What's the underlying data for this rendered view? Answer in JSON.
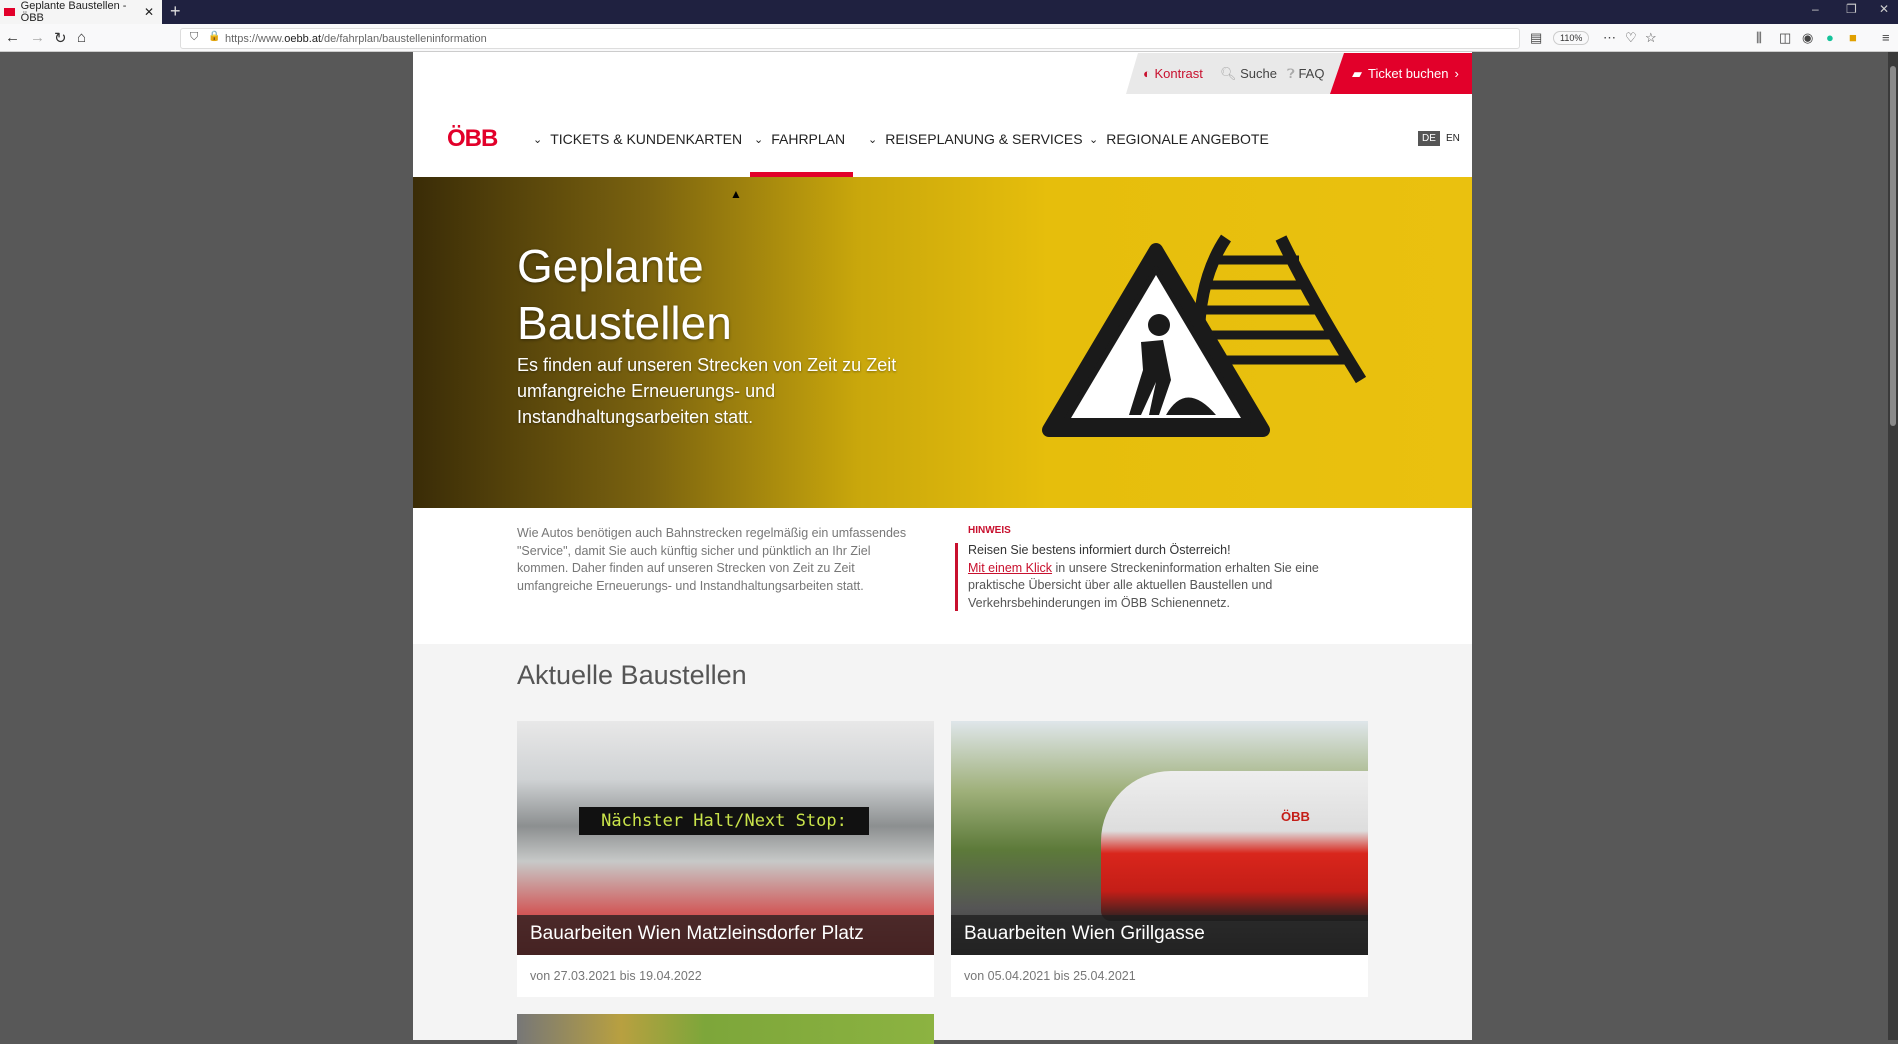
{
  "browser": {
    "tab_title": "Geplante Baustellen - ÖBB",
    "url_prefix": "https://www.",
    "url_domain": "oebb.at",
    "url_path": "/de/fahrplan/baustelleninformation",
    "zoom": "110%"
  },
  "utility": {
    "kontrast": "Kontrast",
    "suche": "Suche",
    "faq": "FAQ",
    "ticket": "Ticket buchen"
  },
  "logo": "ÖBB",
  "nav": [
    {
      "label": "TICKETS & KUNDENKARTEN"
    },
    {
      "label": "FAHRPLAN",
      "active": true
    },
    {
      "label": "REISEPLANUNG & SERVICES"
    },
    {
      "label": "REGIONALE ANGEBOTE"
    }
  ],
  "lang": {
    "de": "DE",
    "en": "EN",
    "active": "DE"
  },
  "hero": {
    "title": "Geplante Baustellen",
    "subtitle": "Es finden auf unseren Strecken von Zeit zu Zeit umfangreiche Erneuerungs- und Instandhaltungsarbeiten statt."
  },
  "intro": "Wie Autos benötigen auch Bahnstrecken regelmäßig ein umfassendes \"Service\", damit Sie auch künftig sicher und pünktlich an Ihr Ziel kommen. Daher finden auf unseren Strecken von Zeit zu Zeit umfangreiche Erneuerungs- und Instandhaltungsarbeiten statt.",
  "hinweis": {
    "label": "HINWEIS",
    "headline": "Reisen Sie bestens informiert durch Österreich!",
    "link": "Mit einem Klick",
    "text": " in unsere Streckeninformation erhalten Sie eine praktische Übersicht über alle aktuellen Baustellen und Verkehrsbehinderungen im ÖBB Schienennetz."
  },
  "section_title": "Aktuelle Baustellen",
  "cards": [
    {
      "title": "Bauarbeiten Wien Matzleinsdorfer Platz",
      "date": "von 27.03.2021 bis 19.04.2022",
      "display_text": "Nächster Halt/Next Stop:"
    },
    {
      "title": "Bauarbeiten Wien Grillgasse",
      "date": "von 05.04.2021 bis 25.04.2021",
      "train_logo": "ÖBB"
    }
  ],
  "colors": {
    "brand": "#e2002a",
    "hero": "#eac10f"
  }
}
